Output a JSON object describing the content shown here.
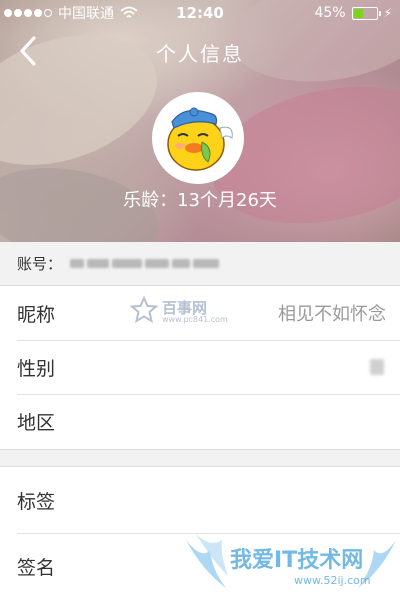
{
  "status_bar": {
    "carrier": "中国联通",
    "time": "12:40",
    "battery_percent": "45%",
    "battery_level": 0.45
  },
  "nav": {
    "title": "个人信息",
    "back_icon": "chevron-left-icon"
  },
  "profile": {
    "avatar_icon": "cartoon-duck-avatar",
    "age_text": "乐龄：13个月26天"
  },
  "account": {
    "label": "账号："
  },
  "rows_group1": [
    {
      "label": "昵称",
      "value": "相见不如怀念"
    },
    {
      "label": "性别",
      "value": ""
    },
    {
      "label": "地区",
      "value": ""
    }
  ],
  "rows_group2": [
    {
      "label": "标签"
    },
    {
      "label": "签名"
    }
  ],
  "watermarks": {
    "top_brand": "百事网",
    "top_url": "www.pc841.com",
    "bottom_brand": "我爱IT技术网",
    "bottom_url": "www.52ij.com"
  },
  "colors": {
    "battery_fill": "#7ed321",
    "value_text": "#9a9a9a",
    "label_text": "#333333"
  }
}
